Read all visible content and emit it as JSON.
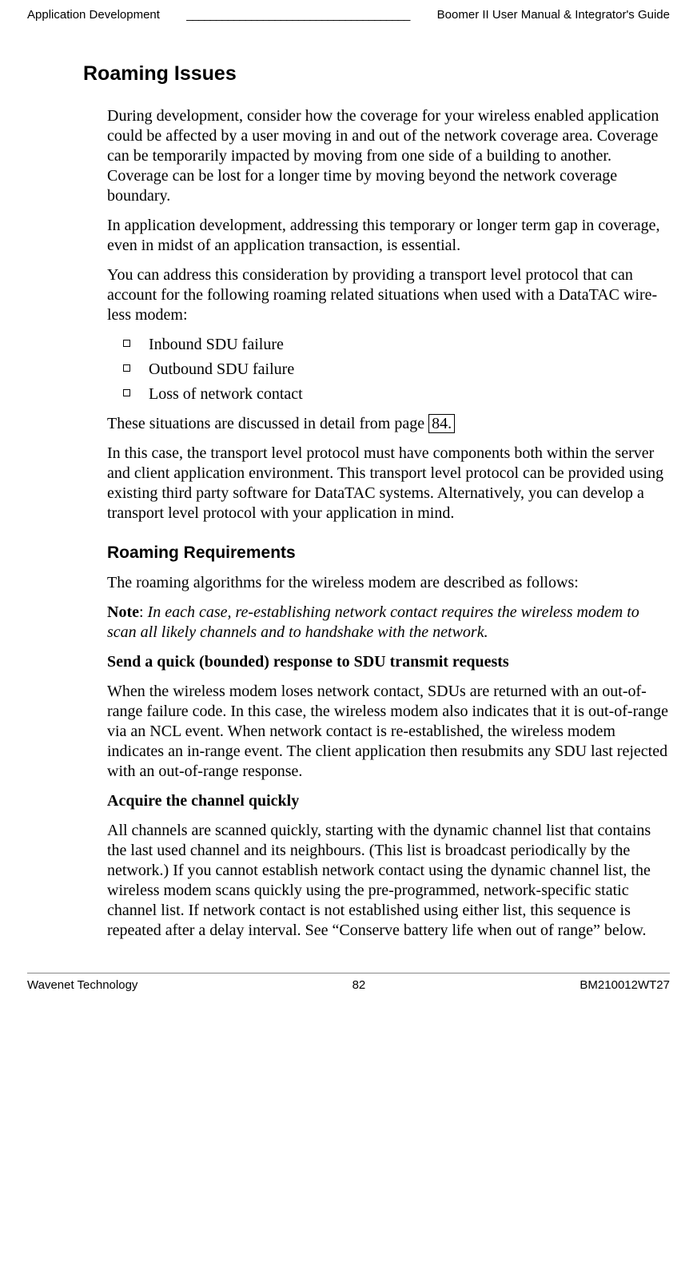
{
  "header": {
    "left": "Application Development",
    "underscore": " ______________________________________",
    "right": " Boomer II User Manual & Integrator's Guide"
  },
  "section_title": "Roaming Issues",
  "p1": "During development, consider how the coverage for your wireless enabled application could be affected by a user moving in and out of the network coverage area. Coverage can be temporarily impacted by moving from one side of a building to another. Coverage can be lost for a longer time by moving beyond the network coverage boundary.",
  "p2": "In application development, addressing this temporary or longer term gap in coverage, even in midst of an application transaction, is essential.",
  "p3": "You can address this consideration by providing a transport level protocol that can account for the following roaming related situations when used with a DataTAC wire-less modem:",
  "list": {
    "i1": "Inbound SDU failure",
    "i2": "Outbound SDU failure",
    "i3": "Loss of network contact"
  },
  "p4_pre": "These situations are discussed in detail from page ",
  "p4_link": "84.",
  "p5": "In this case, the transport level protocol must have components both within the server and client application environment. This transport level protocol can be provided using existing third party software for DataTAC systems. Alternatively, you can develop a transport level protocol with your application in mind.",
  "subsection": "Roaming Requirements",
  "p6": "The roaming algorithms for the wireless modem are described as follows:",
  "note_label": "Note",
  "note_colon": ": ",
  "note_body": "In each case, re-establishing network contact requires the wireless modem to scan all likely channels and to handshake with the network.",
  "h_send": "Send a quick (bounded) response to SDU transmit requests",
  "p_send": "When the wireless modem loses network contact, SDUs are returned with an out-of-range failure code. In this case, the wireless modem also indicates that it is out-of-range via an NCL event. When network contact is re-established, the wireless modem indicates an in-range event. The client application then resubmits any SDU last rejected with an out-of-range response.",
  "h_acquire": "Acquire the channel quickly",
  "p_acquire": "All channels are scanned quickly, starting with the dynamic channel list that contains the last used channel and its neighbours. (This list is broadcast periodically by the network.) If you cannot establish network contact using the dynamic channel list, the wireless modem scans quickly using the pre-programmed, network-specific static channel list. If network contact is not established using either list, this sequence is repeated after a delay interval. See “Conserve battery life when out of range” below.",
  "footer": {
    "left": "Wavenet Technology",
    "center": "82",
    "right": "BM210012WT27"
  }
}
